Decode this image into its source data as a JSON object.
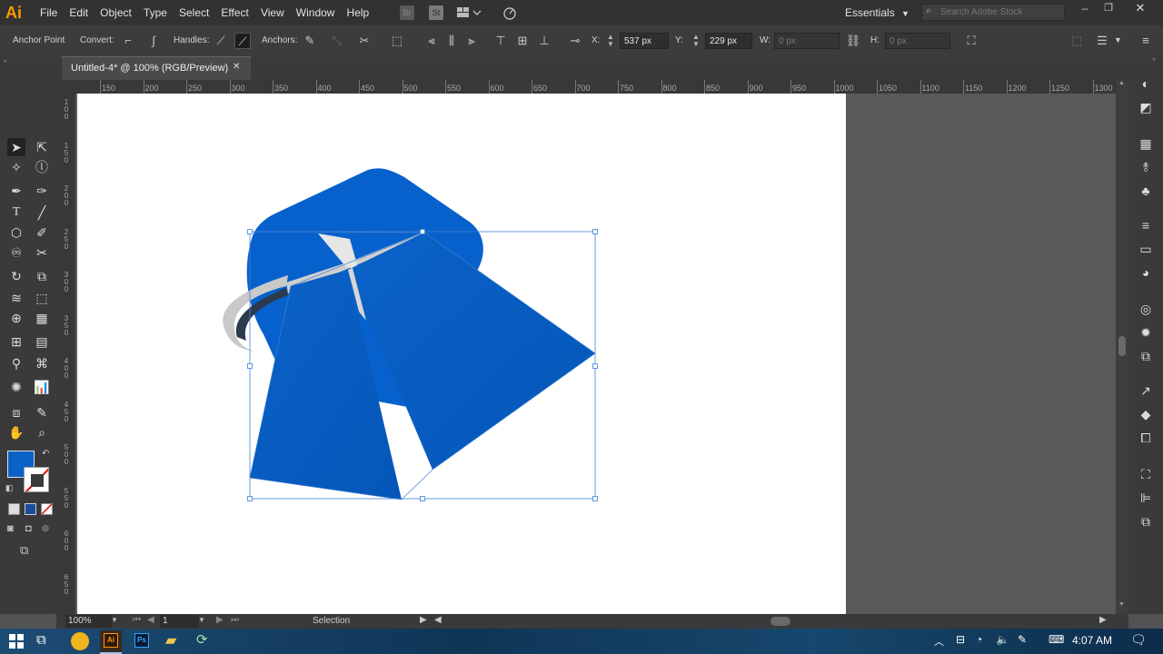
{
  "app": {
    "logo": "Ai",
    "brand_color": "#ff9a00"
  },
  "menu": [
    "File",
    "Edit",
    "Object",
    "Type",
    "Select",
    "Effect",
    "View",
    "Window",
    "Help"
  ],
  "workspace": {
    "name": "Essentials",
    "search_placeholder": "Search Adobe Stock"
  },
  "bridge_labels": {
    "br": "Br",
    "st": "St"
  },
  "control_bar": {
    "selection_type": "Anchor Point",
    "convert_label": "Convert:",
    "handles_label": "Handles:",
    "anchors_label": "Anchors:",
    "x_label": "X:",
    "x_value": "537 px",
    "y_label": "Y:",
    "y_value": "229 px",
    "w_label": "W:",
    "w_value": "0 px",
    "h_label": "H:",
    "h_value": "0 px"
  },
  "document": {
    "tab_title": "Untitled-4* @ 100% (RGB/Preview)",
    "close": "✕"
  },
  "ruler_h": [
    "150",
    "200",
    "250",
    "300",
    "350",
    "400",
    "450",
    "500",
    "550",
    "600",
    "650",
    "700",
    "750",
    "800",
    "850",
    "900",
    "950",
    "1000",
    "1050",
    "1100",
    "1150",
    "1200",
    "1250",
    "1300"
  ],
  "ruler_v": [
    "100",
    "150",
    "200",
    "250",
    "300",
    "350",
    "400",
    "450",
    "500",
    "550",
    "600",
    "650"
  ],
  "colors": {
    "fill": "#0a62c8",
    "shape_blue": "#0761cc",
    "selection": "#3c7fd6",
    "accent": "#3c7fd6"
  },
  "status": {
    "zoom": "100%",
    "artboard": "1",
    "tool": "Selection"
  },
  "taskbar": {
    "time": "4:07 AM"
  }
}
